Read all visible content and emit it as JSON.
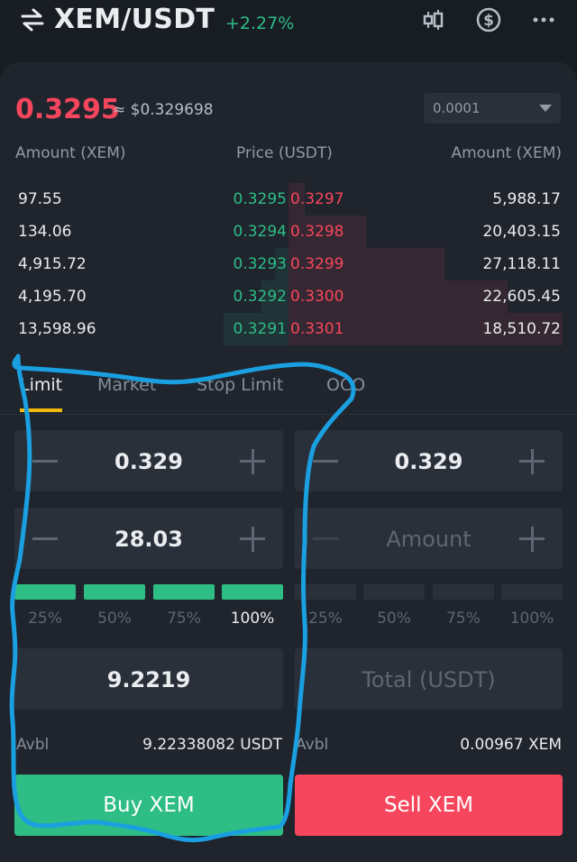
{
  "header": {
    "pair": "XEM/USDT",
    "change": "+2.27%",
    "icons": [
      "swap-icon",
      "candlestick-chart-icon",
      "dollar-circle-icon",
      "more-icon"
    ]
  },
  "price_bar": {
    "last_price": "0.3295",
    "approx_usd": "≈ $0.329698",
    "tick_size": "0.0001"
  },
  "orderbook": {
    "headers": [
      "Amount (XEM)",
      "Price (USDT)",
      "Amount (XEM)"
    ],
    "rows": [
      {
        "bid_amount": "97.55",
        "bid_price": "0.3295",
        "ask_price": "0.3297",
        "ask_amount": "5,988.17",
        "bid_depth": 0.0,
        "ask_depth": 0.057
      },
      {
        "bid_amount": "134.06",
        "bid_price": "0.3294",
        "ask_price": "0.3298",
        "ask_amount": "20,403.15",
        "bid_depth": 0.0,
        "ask_depth": 0.27
      },
      {
        "bid_amount": "4,915.72",
        "bid_price": "0.3293",
        "ask_price": "0.3299",
        "ask_amount": "27,118.11",
        "bid_depth": 0.047,
        "ask_depth": 0.54
      },
      {
        "bid_amount": "4,195.70",
        "bid_price": "0.3292",
        "ask_price": "0.3300",
        "ask_amount": "22,605.45",
        "bid_depth": 0.094,
        "ask_depth": 0.76
      },
      {
        "bid_amount": "13,598.96",
        "bid_price": "0.3291",
        "ask_price": "0.3301",
        "ask_amount": "18,510.72",
        "bid_depth": 0.225,
        "ask_depth": 0.95
      }
    ]
  },
  "tabs": [
    {
      "label": "Limit",
      "active": true
    },
    {
      "label": "Market",
      "active": false
    },
    {
      "label": "Stop Limit",
      "active": false
    },
    {
      "label": "OCO",
      "active": false
    }
  ],
  "buy": {
    "price": "0.329",
    "amount": "28.03",
    "percent_options": [
      "25%",
      "50%",
      "75%",
      "100%"
    ],
    "selected_percent": "100%",
    "total": "9.2219",
    "avbl_label": "Avbl",
    "avbl_value": "9.22338082 USDT",
    "button": "Buy XEM"
  },
  "sell": {
    "price": "0.329",
    "amount_placeholder": "Amount",
    "percent_options": [
      "25%",
      "50%",
      "75%",
      "100%"
    ],
    "total_placeholder": "Total (USDT)",
    "avbl_label": "Avbl",
    "avbl_value": "0.00967 XEM",
    "button": "Sell XEM"
  },
  "colors": {
    "buy": "#2ebd85",
    "sell": "#f6465d",
    "accent": "#f0b90b",
    "annotation": "#1a9fe0"
  }
}
